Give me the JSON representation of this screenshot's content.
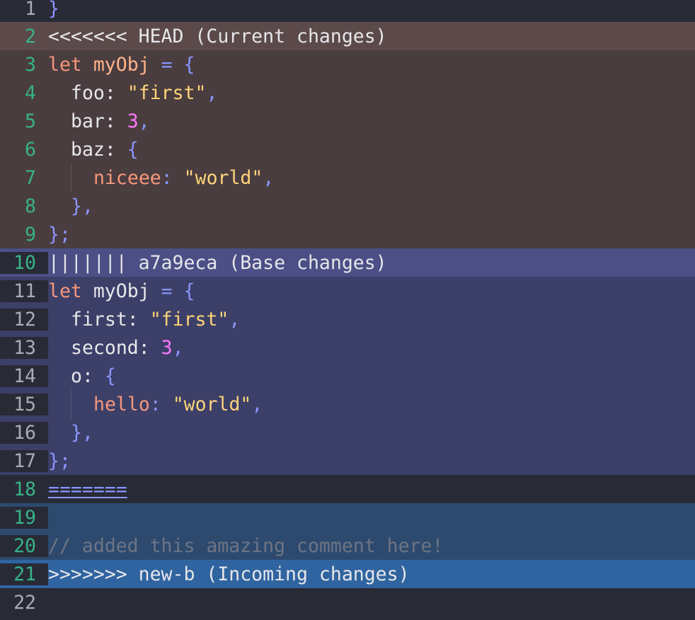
{
  "editor": {
    "lines": [
      {
        "n": "1"
      },
      {
        "n": "2"
      },
      {
        "n": "3"
      },
      {
        "n": "4"
      },
      {
        "n": "5"
      },
      {
        "n": "6"
      },
      {
        "n": "7"
      },
      {
        "n": "8"
      },
      {
        "n": "9"
      },
      {
        "n": "10"
      },
      {
        "n": "11"
      },
      {
        "n": "12"
      },
      {
        "n": "13"
      },
      {
        "n": "14"
      },
      {
        "n": "15"
      },
      {
        "n": "16"
      },
      {
        "n": "17"
      },
      {
        "n": "18"
      },
      {
        "n": "19"
      },
      {
        "n": "20"
      },
      {
        "n": "21"
      },
      {
        "n": "22"
      }
    ],
    "head_marker": "<<<<<<< HEAD (Current changes)",
    "base_marker": "||||||| a7a9eca (Base changes)",
    "sep_marker": "=======",
    "incoming_marker": ">>>>>>> new-b (Incoming changes)",
    "comment": "// added this amazing comment here!",
    "kw_let": "let",
    "var_name": "myObj",
    "head": {
      "foo_key": "foo",
      "foo_val": "\"first\"",
      "bar_key": "bar",
      "bar_val": "3",
      "baz_key": "baz",
      "niceee_key": "niceee",
      "niceee_val": "\"world\""
    },
    "base": {
      "first_key": "first",
      "first_val": "\"first\"",
      "second_key": "second",
      "second_val": "3",
      "o_key": "o",
      "hello_key": "hello",
      "hello_val": "\"world\""
    }
  },
  "colors": {
    "background": "#282a36",
    "head_header": "#5c4a4a",
    "head_body": "#4a3d3f",
    "base_header": "#4b4f86",
    "base_body": "#3c3f68",
    "incoming_body": "#2d4a6e",
    "incoming_header": "#3064a0"
  }
}
